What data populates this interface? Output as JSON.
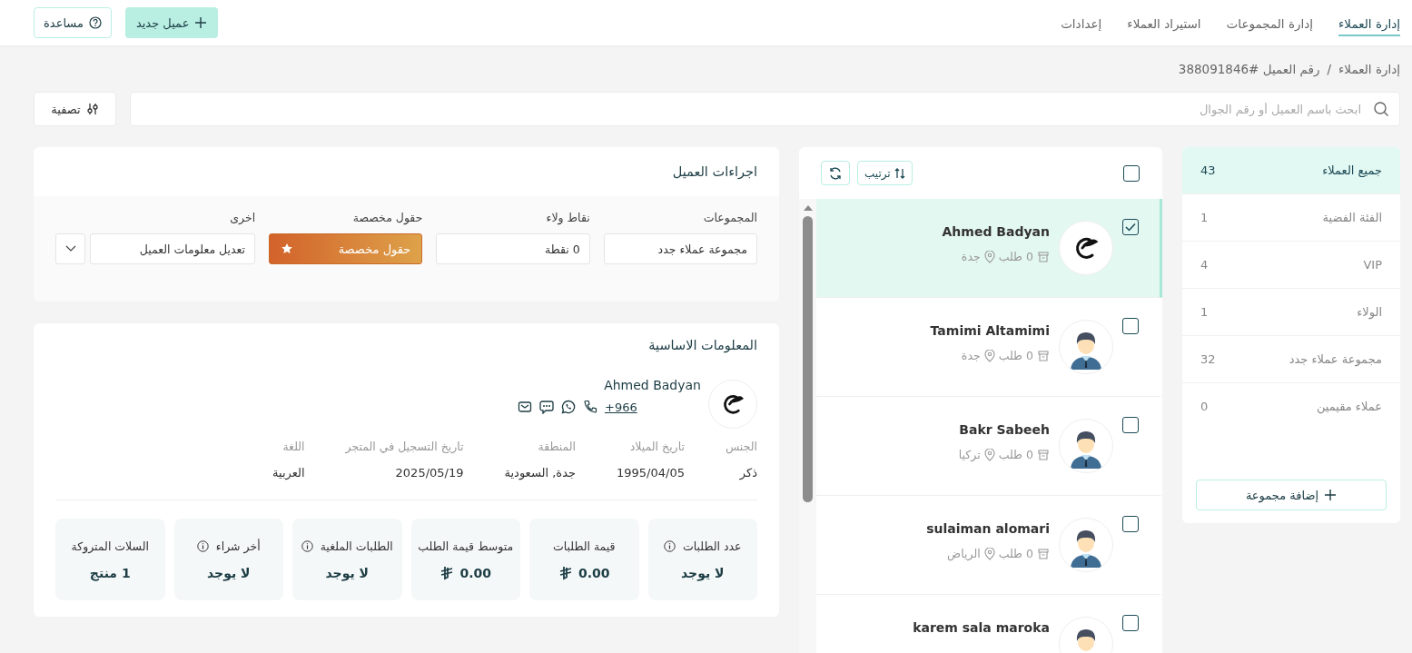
{
  "nav": {
    "tabs": [
      {
        "label": "إدارة العملاء",
        "selected": true
      },
      {
        "label": "إدارة المجموعات",
        "selected": false
      },
      {
        "label": "استيراد العملاء",
        "selected": false
      },
      {
        "label": "إعدادات",
        "selected": false
      }
    ],
    "new_button": "عميل جديد",
    "help_button": "مساعدة"
  },
  "breadcrumb": {
    "items": [
      "إدارة العملاء",
      "رقم العميل #388091846"
    ],
    "separator": "/"
  },
  "search": {
    "placeholder": "ابحث باسم العميل أو رقم الجوال"
  },
  "filter_button": "تصفية",
  "groups": {
    "items": [
      {
        "label": "جميع العملاء",
        "count": "43",
        "selected": true
      },
      {
        "label": "الفئة الفضية",
        "count": "1",
        "selected": false
      },
      {
        "label": "VIP",
        "count": "4",
        "selected": false
      },
      {
        "label": "الولاء",
        "count": "1",
        "selected": false
      },
      {
        "label": "مجموعة عملاء جدد",
        "count": "32",
        "selected": false
      },
      {
        "label": "عملاء مقيمين",
        "count": "0",
        "selected": false
      }
    ],
    "add_button": "إضافة مجموعة"
  },
  "customer_list": {
    "select_all_checked": false,
    "sort_button": "ترتيب",
    "customers": [
      {
        "name": "Ahmed Badyan",
        "orders": "0 طلب",
        "city": "جدة",
        "kind": "logo",
        "checked": true,
        "selected": true
      },
      {
        "name": "Tamimi Altamimi",
        "orders": "0 طلب",
        "city": "جدة",
        "kind": "person",
        "checked": false,
        "selected": false
      },
      {
        "name": "Bakr Sabeeh",
        "orders": "0 طلب",
        "city": "تركيا",
        "kind": "person",
        "checked": false,
        "selected": false
      },
      {
        "name": "sulaiman alomari",
        "orders": "0 طلب",
        "city": "الرياض",
        "kind": "person",
        "checked": false,
        "selected": false
      },
      {
        "name": "karem sala maroka",
        "kind": "person",
        "checked": false,
        "selected": false
      }
    ]
  },
  "actions": {
    "title": "اجراءات العميل",
    "fields": [
      {
        "label": "المجموعات",
        "value": "مجموعة عملاء جدد",
        "kind": "field"
      },
      {
        "label": "نقاط ولاء",
        "value": "0 نقطة",
        "kind": "field"
      },
      {
        "label": "حقول مخصصة",
        "value": "حقول مخصصة",
        "kind": "accent"
      },
      {
        "label": "اخرى",
        "value": "تعديل معلومات العميل",
        "kind": "dropdown"
      }
    ]
  },
  "basic_info": {
    "title": "المعلومات الاساسية",
    "name": "Ahmed Badyan",
    "phone": "+966",
    "details": [
      {
        "label": "الجنس",
        "value": "ذكر"
      },
      {
        "label": "تاريخ الميلاد",
        "value": "1995/04/05"
      },
      {
        "label": "المنطقة",
        "value": "جدة, السعودية"
      },
      {
        "label": "تاريخ التسجيل في المتجر",
        "value": "2025/05/19"
      },
      {
        "label": "اللغة",
        "value": "العربية"
      }
    ],
    "stats": [
      {
        "label": "عدد الطلبات",
        "info": true,
        "value": "لا يوجد",
        "currency": false
      },
      {
        "label": "قيمة الطلبات",
        "info": false,
        "value": "0.00",
        "currency": true
      },
      {
        "label": "متوسط قيمة الطلب",
        "info": false,
        "value": "0.00",
        "currency": true
      },
      {
        "label": "الطلبات الملغية",
        "info": true,
        "value": "لا يوجد",
        "currency": false
      },
      {
        "label": "أخر شراء",
        "info": true,
        "value": "لا يوجد",
        "currency": false
      },
      {
        "label": "السلات المتروكة",
        "info": false,
        "value": "1 منتج",
        "currency": false
      }
    ]
  }
}
